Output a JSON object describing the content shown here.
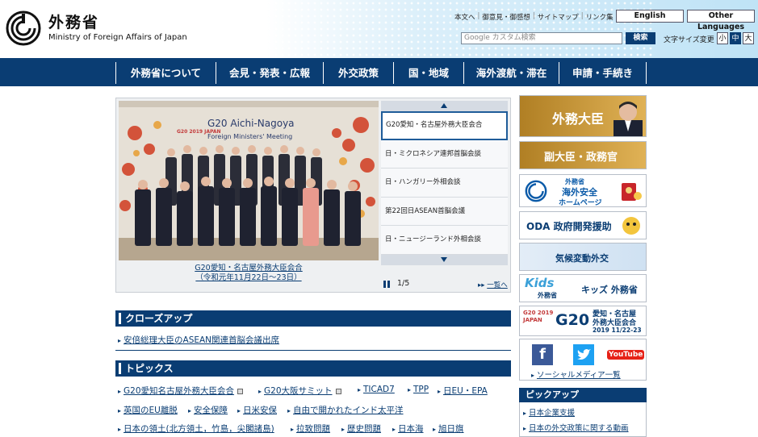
{
  "header": {
    "logo_jp": "外務省",
    "logo_en": "Ministry of Foreign Affairs of Japan",
    "utility_links": [
      "本文へ",
      "御意見・御感想",
      "サイトマップ",
      "リンク集"
    ],
    "english_btn": "English",
    "other_lang_btn": "Other Languages",
    "search_placeholder": "Google カスタム検索",
    "search_btn": "検索",
    "fontsize_label": "文字サイズ変更",
    "fontsize_options": [
      "小",
      "中",
      "大"
    ],
    "fontsize_selected": "中"
  },
  "nav": {
    "items": [
      "外務省について",
      "会見・発表・広報",
      "外交政策",
      "国・地域",
      "海外渡航・滞在",
      "申請・手続き"
    ]
  },
  "slideshow": {
    "photo_title_line1": "G20 Aichi-Nagoya",
    "photo_title_line2": "Foreign Ministers' Meeting",
    "photo_logo": "G20 2019 JAPAN",
    "caption_line1": "G20愛知・名古屋外務大臣会合",
    "caption_line2": "（令和元年11月22日〜23日）",
    "items": [
      "G20愛知・名古屋外務大臣会合",
      "日・ミクロネシア連邦首脳会談",
      "日・ハンガリー外相会談",
      "第22回日ASEAN首脳会議",
      "日・ニュージーランド外相会談"
    ],
    "active_index": 0,
    "counter": "1/5",
    "list_link": "一覧へ"
  },
  "closeup": {
    "title": "クローズアップ",
    "link": "安倍総理大臣のASEAN関連首脳会議出席"
  },
  "topics": {
    "title": "トピックス",
    "row1": [
      "G20愛知名古屋外務大臣会合",
      "G20大阪サミット",
      "TICAD7",
      "TPP",
      "日EU・EPA"
    ],
    "row2": [
      "英国のEU離脱",
      "安全保障",
      "日米安保",
      "自由で開かれたインド太平洋"
    ],
    "row3": [
      "日本の領土(北方領土，竹島，尖閣諸島)",
      "拉致問題",
      "歴史問題",
      "日本海",
      "旭日旗"
    ]
  },
  "sidebar": {
    "minister": "外務大臣",
    "vice_minister": "副大臣・政務官",
    "overseas_safety_small": "外務省",
    "overseas_safety_line1": "海外安全",
    "overseas_safety_line2": "ホームページ",
    "oda": "ODA 政府開発援助",
    "climate": "気候変動外交",
    "kids_logo": "Kids",
    "kids_sub": "外務省",
    "kids_label": "キッズ 外務省",
    "g20_year": "G20 2019 JAPAN",
    "g20_big": "G20",
    "g20_line1": "愛知・名古屋",
    "g20_line2": "外務大臣会合",
    "g20_date": "2019 11/22-23",
    "social_fb": "f",
    "social_yt": "YouTube",
    "social_link": "ソーシャルメディア一覧",
    "pickup_title": "ピックアップ",
    "pickup_items": [
      "日本企業支援",
      "日本の外交政策に関する動画"
    ]
  },
  "colors": {
    "navy": "#0a3d73",
    "header_blue": "#bfe3f6",
    "gold": "#c9962e"
  }
}
